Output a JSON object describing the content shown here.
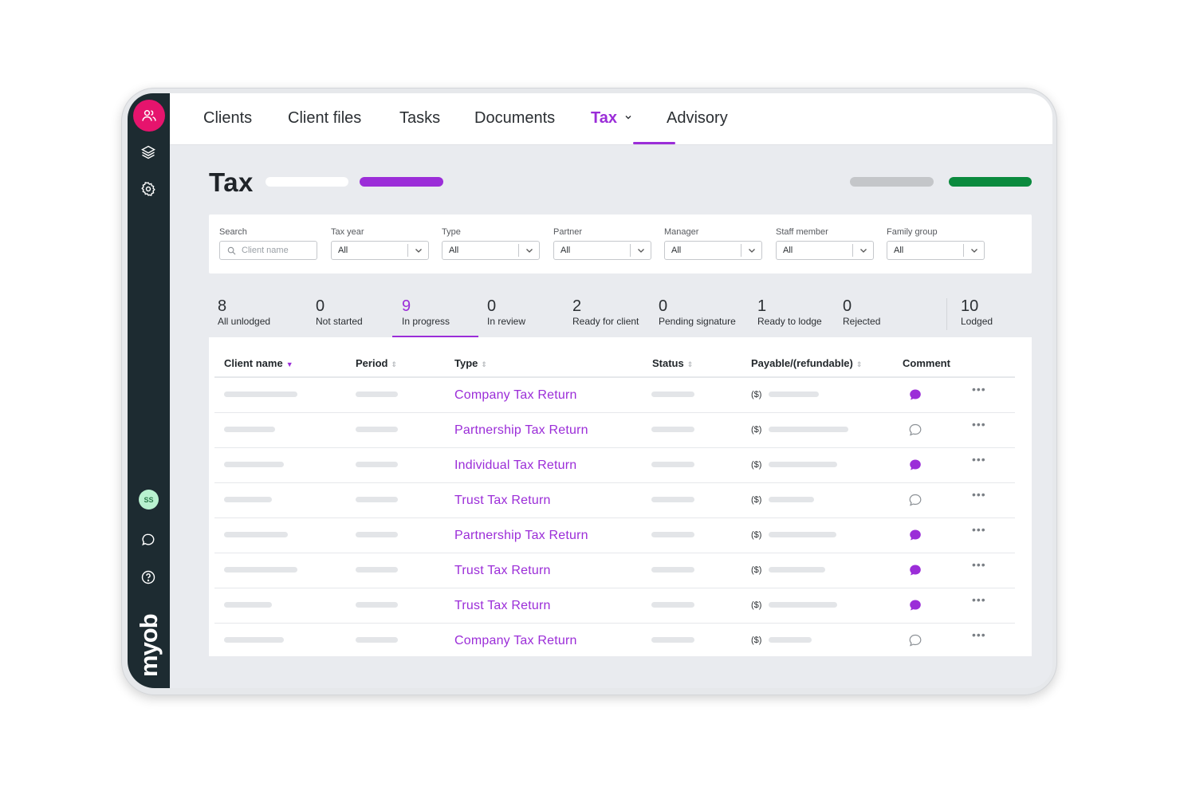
{
  "sidebar": {
    "icons": [
      "people-icon",
      "layers-icon",
      "gear-icon",
      "chat-icon",
      "help-icon"
    ],
    "avatar_initials": "SS",
    "brand": "myob"
  },
  "nav": {
    "tabs": [
      {
        "label": "Clients"
      },
      {
        "label": "Client files"
      },
      {
        "label": "Tasks"
      },
      {
        "label": "Documents"
      },
      {
        "label": "Tax",
        "active": true
      },
      {
        "label": "Advisory"
      }
    ]
  },
  "page": {
    "title": "Tax"
  },
  "filters": {
    "search": {
      "label": "Search",
      "placeholder": "Client name"
    },
    "tax_year": {
      "label": "Tax year",
      "value": "All"
    },
    "type": {
      "label": "Type",
      "value": "All"
    },
    "partner": {
      "label": "Partner",
      "value": "All"
    },
    "manager": {
      "label": "Manager",
      "value": "All"
    },
    "staff_member": {
      "label": "Staff member",
      "value": "All"
    },
    "family_group": {
      "label": "Family group",
      "value": "All"
    }
  },
  "stats": [
    {
      "count": "8",
      "label": "All unlodged"
    },
    {
      "count": "0",
      "label": "Not started"
    },
    {
      "count": "9",
      "label": "In progress",
      "active": true
    },
    {
      "count": "0",
      "label": "In review"
    },
    {
      "count": "2",
      "label": "Ready for client"
    },
    {
      "count": "0",
      "label": "Pending signature"
    },
    {
      "count": "1",
      "label": "Ready to lodge"
    },
    {
      "count": "0",
      "label": "Rejected"
    },
    {
      "count": "10",
      "label": "Lodged"
    }
  ],
  "table": {
    "headers": {
      "client_name": "Client name",
      "period": "Period",
      "type": "Type",
      "status": "Status",
      "payable": "Payable/(refundable)",
      "comment": "Comment"
    },
    "rows": [
      {
        "type": "Company Tax Return",
        "payable_prefix": "($)",
        "has_comment": true
      },
      {
        "type": "Partnership Tax Return",
        "payable_prefix": "($)",
        "has_comment": false
      },
      {
        "type": "Individual Tax Return",
        "payable_prefix": "($)",
        "has_comment": true
      },
      {
        "type": "Trust Tax Return",
        "payable_prefix": "($)",
        "has_comment": false
      },
      {
        "type": "Partnership Tax Return",
        "payable_prefix": "($)",
        "has_comment": true
      },
      {
        "type": "Trust Tax Return",
        "payable_prefix": "($)",
        "has_comment": true
      },
      {
        "type": "Trust Tax Return",
        "payable_prefix": "($)",
        "has_comment": true
      },
      {
        "type": "Company Tax Return",
        "payable_prefix": "($)",
        "has_comment": false
      }
    ]
  },
  "colors": {
    "accent": "#9b2dd8",
    "brand_pink": "#e6146d",
    "rail": "#1d2b31",
    "success": "#0b8a3e"
  }
}
